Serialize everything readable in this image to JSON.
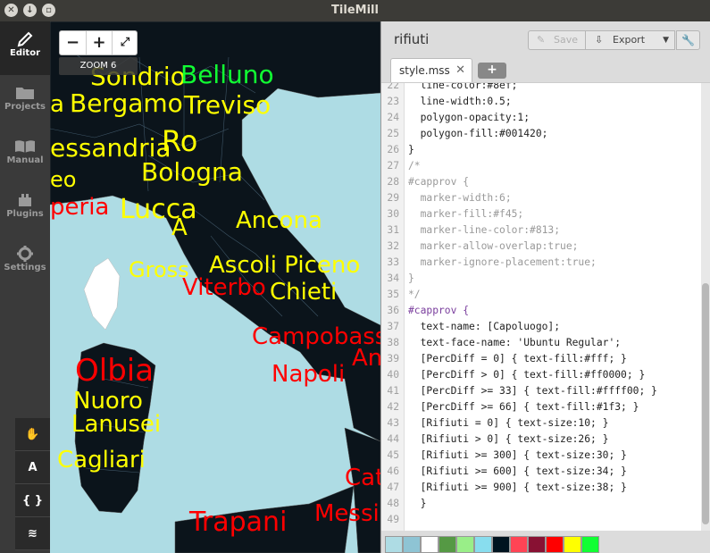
{
  "window": {
    "title": "TileMill"
  },
  "sidebar": {
    "items": [
      {
        "label": "Editor",
        "icon": "pencil-icon",
        "active": true
      },
      {
        "label": "Projects",
        "icon": "folder-icon",
        "active": false
      },
      {
        "label": "Manual",
        "icon": "book-icon",
        "active": false
      },
      {
        "label": "Plugins",
        "icon": "plugin-icon",
        "active": false
      },
      {
        "label": "Settings",
        "icon": "gear-icon",
        "active": false
      }
    ],
    "tools": [
      {
        "name": "pan-tool",
        "icon": "hand-icon",
        "glyph": "✋"
      },
      {
        "name": "font-tool",
        "icon": "font-icon",
        "glyph": "A"
      },
      {
        "name": "carto-tool",
        "icon": "braces-icon",
        "glyph": "{ }"
      },
      {
        "name": "layers-tool",
        "icon": "layers-icon",
        "glyph": "≋"
      }
    ]
  },
  "map": {
    "zoom_label": "ZOOM 6",
    "zoom_out": "−",
    "zoom_in": "+",
    "fullscreen": "⤢",
    "labels": [
      {
        "text": "Sondrio",
        "color": "#ffff00"
      },
      {
        "text": "Belluno",
        "color": "#11ff33"
      },
      {
        "text": "a",
        "color": "#ffff00"
      },
      {
        "text": "Bergamo",
        "color": "#ffff00"
      },
      {
        "text": "Treviso",
        "color": "#ffff00"
      },
      {
        "text": "essandria",
        "color": "#ffff00"
      },
      {
        "text": "Ro",
        "color": "#ffff00"
      },
      {
        "text": "Bologna",
        "color": "#ffff00"
      },
      {
        "text": "eo",
        "color": "#ffff00"
      },
      {
        "text": "peria",
        "color": "#ff0000"
      },
      {
        "text": "Lucca",
        "color": "#ffff00"
      },
      {
        "text": "A",
        "color": "#ffff00"
      },
      {
        "text": "Ancona",
        "color": "#ffff00"
      },
      {
        "text": "Gross",
        "color": "#ffff00"
      },
      {
        "text": "Ascoli Piceno",
        "color": "#ffff00"
      },
      {
        "text": "Viterbo",
        "color": "#ff0000"
      },
      {
        "text": "Chieti",
        "color": "#ffff00"
      },
      {
        "text": "Campobass",
        "color": "#ff0000"
      },
      {
        "text": "An",
        "color": "#ff0000"
      },
      {
        "text": "Olbia",
        "color": "#ff0000"
      },
      {
        "text": "Napoli",
        "color": "#ff0000"
      },
      {
        "text": "Nuoro",
        "color": "#ffff00"
      },
      {
        "text": "Lanusei",
        "color": "#ffff00"
      },
      {
        "text": "Cagliari",
        "color": "#ffff00"
      },
      {
        "text": "Cat",
        "color": "#ff0000"
      },
      {
        "text": "Messi",
        "color": "#ff0000"
      },
      {
        "text": "Trapani",
        "color": "#ff0000"
      }
    ]
  },
  "editor": {
    "project_title": "rifiuti",
    "save_label": "Save",
    "export_label": "Export",
    "tab_label": "style.mss",
    "tab_add": "+",
    "lines": [
      {
        "n": "22",
        "text": "  line-color:#8ef;"
      },
      {
        "n": "23",
        "text": "  line-width:0.5;"
      },
      {
        "n": "24",
        "text": "  polygon-opacity:1;"
      },
      {
        "n": "25",
        "text": "  polygon-fill:#001420;"
      },
      {
        "n": "26",
        "text": "}"
      },
      {
        "n": "27",
        "text": "/*"
      },
      {
        "n": "28",
        "text": "#capprov {"
      },
      {
        "n": "29",
        "text": "  marker-width:6;"
      },
      {
        "n": "30",
        "text": "  marker-fill:#f45;"
      },
      {
        "n": "31",
        "text": "  marker-line-color:#813;"
      },
      {
        "n": "32",
        "text": "  marker-allow-overlap:true;"
      },
      {
        "n": "33",
        "text": "  marker-ignore-placement:true;"
      },
      {
        "n": "34",
        "text": "}"
      },
      {
        "n": "35",
        "text": "*/"
      },
      {
        "n": "36",
        "text": "#capprov {"
      },
      {
        "n": "37",
        "text": "  text-name: [Capoluogo];"
      },
      {
        "n": "38",
        "text": "  text-face-name: 'Ubuntu Regular';"
      },
      {
        "n": "39",
        "text": "  [PercDiff = 0] { text-fill:#fff; }"
      },
      {
        "n": "40",
        "text": "  [PercDiff > 0] { text-fill:#ff0000; }"
      },
      {
        "n": "41",
        "text": "  [PercDiff >= 33] { text-fill:#ffff00; }"
      },
      {
        "n": "42",
        "text": "  [PercDiff >= 66] { text-fill:#1f3; }"
      },
      {
        "n": "43",
        "text": "  [Rifiuti = 0] { text-size:10; }"
      },
      {
        "n": "44",
        "text": "  [Rifiuti > 0] { text-size:26; }"
      },
      {
        "n": "45",
        "text": "  [Rifiuti >= 300] { text-size:30; }"
      },
      {
        "n": "46",
        "text": "  [Rifiuti >= 600] { text-size:34; }"
      },
      {
        "n": "47",
        "text": "  [Rifiuti >= 900] { text-size:38; }"
      },
      {
        "n": "48",
        "text": "  }"
      },
      {
        "n": "49",
        "text": ""
      }
    ],
    "palette": [
      "#aedce4",
      "#8ec4d4",
      "#ffffff",
      "#559944",
      "#99ee88",
      "#88ddee",
      "#001420",
      "#ff4455",
      "#881133",
      "#ff0000",
      "#ffff00",
      "#11ff33"
    ]
  }
}
